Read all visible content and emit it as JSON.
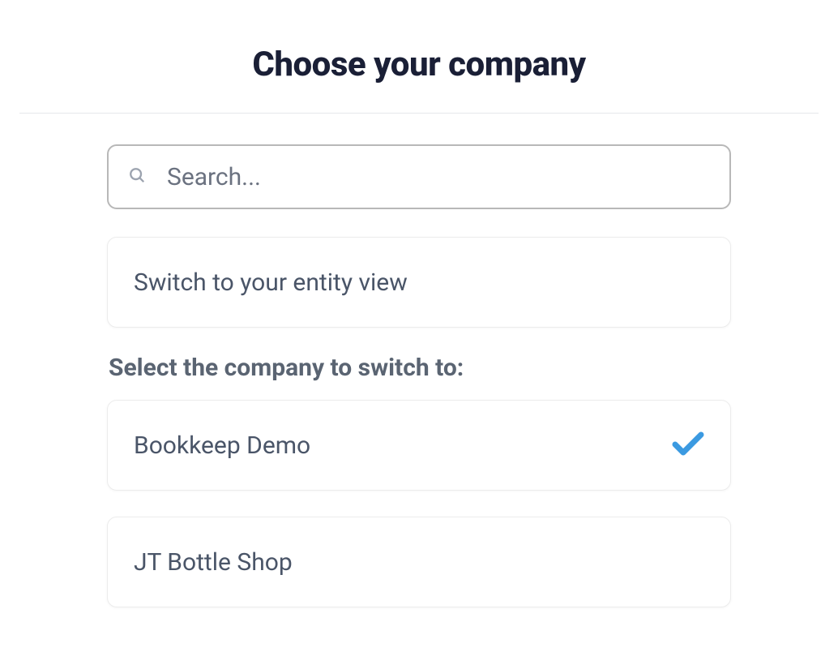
{
  "title": "Choose your company",
  "search": {
    "placeholder": "Search..."
  },
  "entity_view": {
    "label": "Switch to your entity view"
  },
  "section_heading": "Select the company to switch to:",
  "companies": [
    {
      "name": "Bookkeep Demo",
      "selected": true
    },
    {
      "name": "JT Bottle Shop",
      "selected": false
    }
  ],
  "colors": {
    "check": "#3b9ae1"
  }
}
